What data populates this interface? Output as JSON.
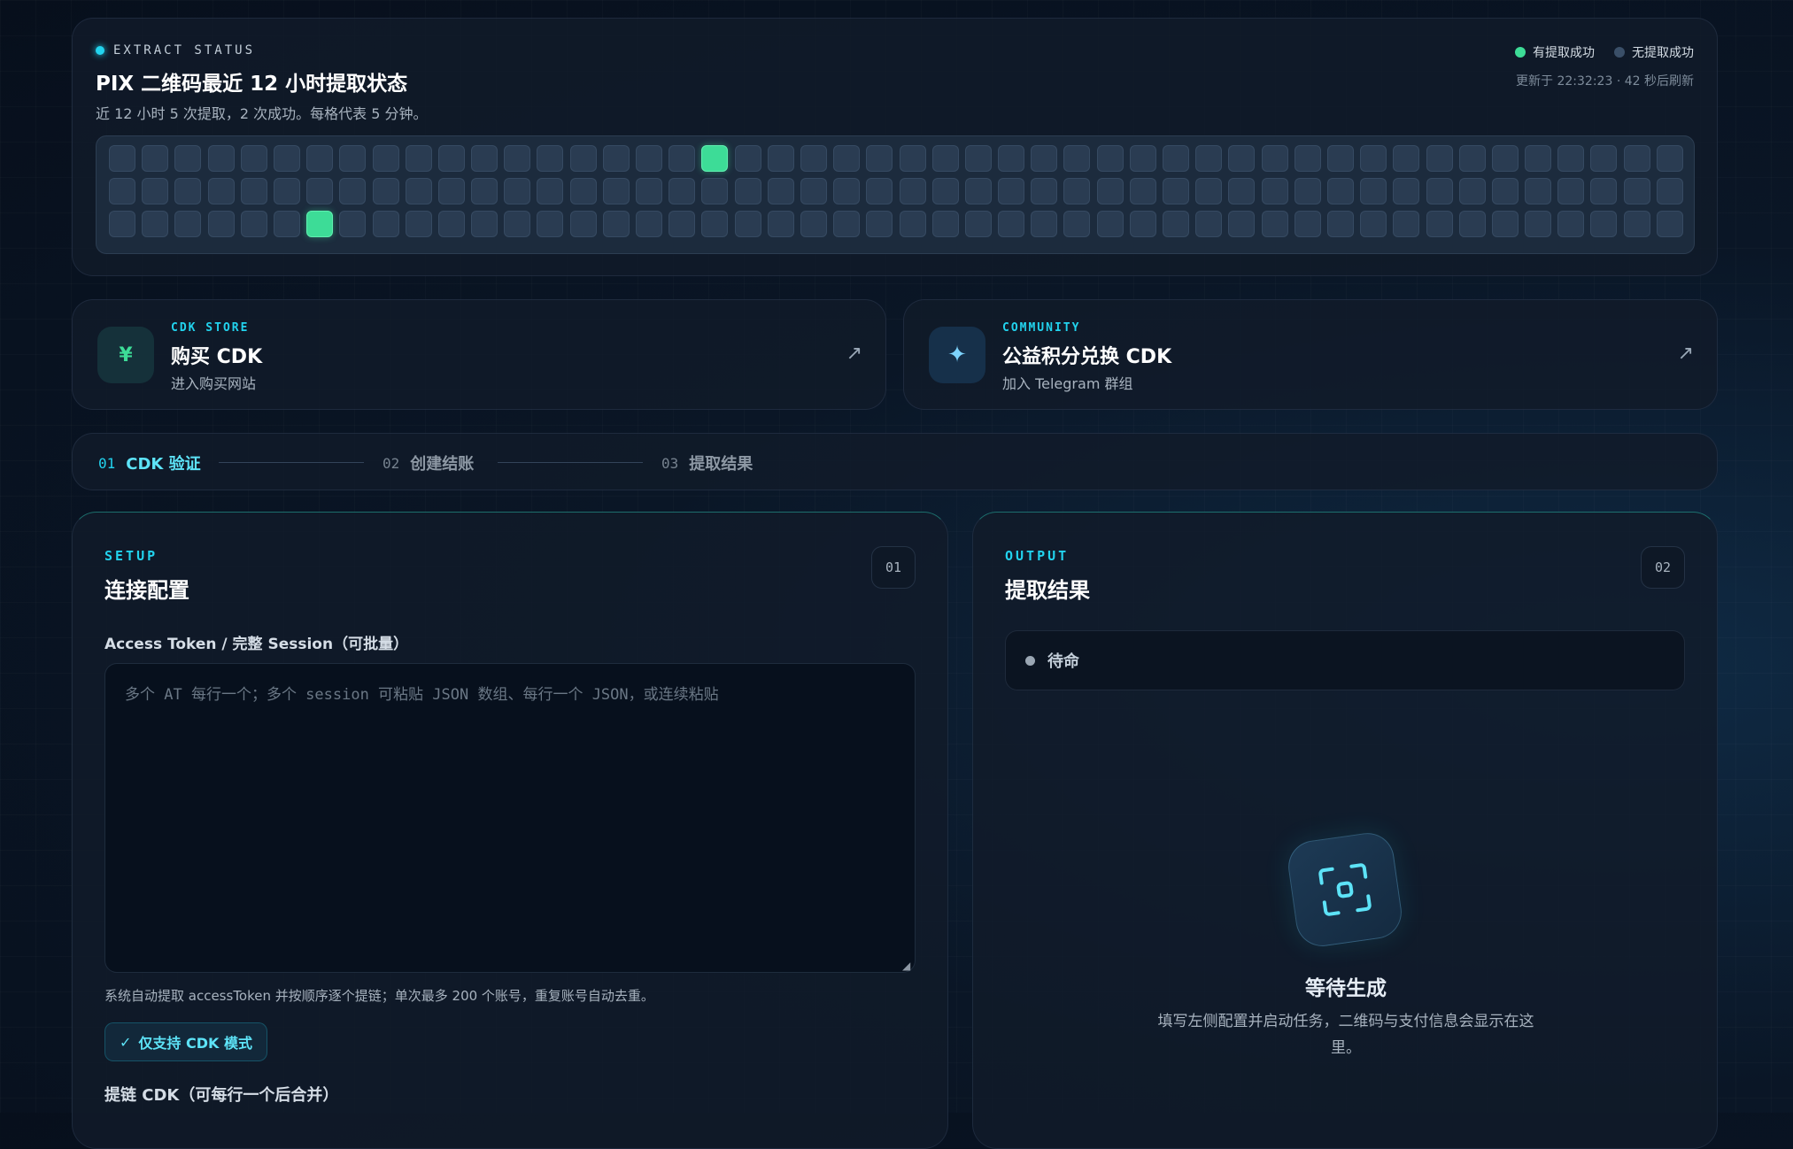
{
  "status": {
    "eyebrow": "EXTRACT STATUS",
    "title": "PIX 二维码最近 12 小时提取状态",
    "subtitle": "近 12 小时 5 次提取，2 次成功。每格代表 5 分钟。",
    "legend": [
      {
        "label": "有提取成功",
        "color": "#3ddc97"
      },
      {
        "label": "无提取成功",
        "color": "#3a4f68"
      }
    ],
    "updated": "更新于 22:32:23 · 42 秒后刷新",
    "heatmap": {
      "rows": 3,
      "cols": 48,
      "success_cells": [
        [
          0,
          18
        ],
        [
          2,
          6
        ]
      ]
    }
  },
  "links": {
    "buy": {
      "eyebrow": "CDK STORE",
      "title": "购买 CDK",
      "subtitle": "进入购买网站",
      "icon": "¥",
      "arrow": "↗"
    },
    "community": {
      "eyebrow": "COMMUNITY",
      "title": "公益积分兑换 CDK",
      "subtitle": "加入 Telegram 群组",
      "icon": "✦",
      "arrow": "↗"
    }
  },
  "steps": [
    {
      "num": "01",
      "label": "CDK 验证",
      "active": true
    },
    {
      "num": "02",
      "label": "创建结账",
      "active": false
    },
    {
      "num": "03",
      "label": "提取结果",
      "active": false
    }
  ],
  "setup": {
    "eyebrow": "SETUP",
    "title": "连接配置",
    "badge": "01",
    "field_label": "Access Token / 完整 Session（可批量）",
    "input_value": "",
    "input_placeholder": "多个 AT 每行一个；多个 session 可粘贴 JSON 数组、每行一个 JSON，或连续粘贴",
    "hint": "系统自动提取 accessToken 并按顺序逐个提链；单次最多 200 个账号，重复账号自动去重。",
    "mode_check": "✓",
    "mode_label": "仅支持 CDK 模式",
    "cdk_label": "提链 CDK（可每行一个后合并）"
  },
  "output": {
    "eyebrow": "OUTPUT",
    "title": "提取结果",
    "badge": "02",
    "status": "待命",
    "wait_title": "等待生成",
    "wait_desc": "填写左侧配置并启动任务，二维码与支付信息会显示在这里。"
  }
}
